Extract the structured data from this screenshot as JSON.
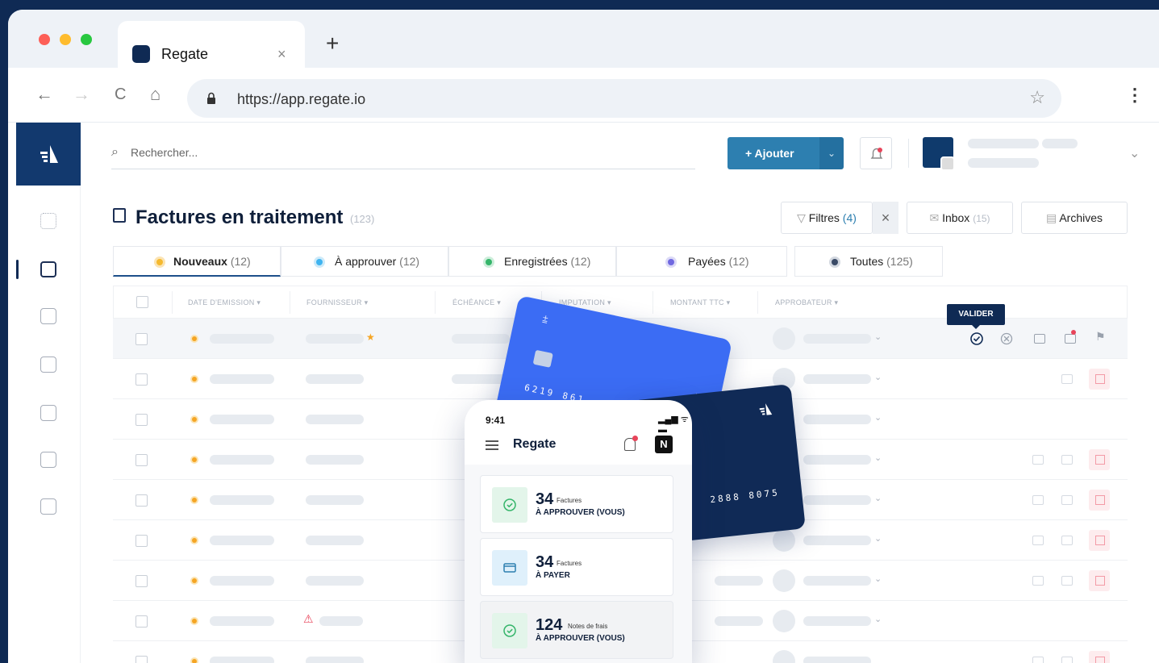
{
  "browser": {
    "tab_title": "Regate",
    "tab_close": "×",
    "new_tab": "+",
    "url": "https://app.regate.io",
    "star": "☆",
    "menu": "⋮",
    "back": "←",
    "forward": "→",
    "reload": "C",
    "home": "⌂"
  },
  "toolbar": {
    "search_placeholder": "Rechercher...",
    "add_label": "+  Ajouter",
    "add_dropdown": "⌄"
  },
  "page": {
    "title": "Factures en traitement",
    "count": "(123)"
  },
  "header_buttons": {
    "filters_label": "Filtres",
    "filters_count": "(4)",
    "filters_clear": "×",
    "inbox_label": "Inbox",
    "inbox_count": "(15)",
    "archives_label": "Archives"
  },
  "status_tabs": [
    {
      "label": "Nouveaux",
      "count": "(12)",
      "color": "#f5b92e"
    },
    {
      "label": "À approuver",
      "count": "(12)",
      "color": "#3fb4f0"
    },
    {
      "label": "Enregistrées",
      "count": "(12)",
      "color": "#35b56a"
    },
    {
      "label": "Payées",
      "count": "(12)",
      "color": "#7068e0"
    },
    {
      "label": "Toutes",
      "count": "(125)",
      "color": "#3a4a66"
    }
  ],
  "table": {
    "columns": [
      "DATE D'EMISSION ▾",
      "FOURNISSEUR ▾",
      "ÉCHÉANCE ▾",
      "IMPUTATION ▾",
      "MONTANT TTC ▾",
      "APPROBATEUR ▾"
    ],
    "tooltip": "VALIDER"
  },
  "mobile": {
    "time": "9:41",
    "status": "▂▄▆ ᯤ ▬",
    "app_name": "Regate",
    "n_logo": "N",
    "cards": [
      {
        "number": "34",
        "small": "Factures",
        "big": "À APPROUVER (VOUS)"
      },
      {
        "number": "34",
        "small": "Factures",
        "big": "À PAYER"
      },
      {
        "number": "124",
        "small": "Notes de frais",
        "big": "À APPROUVER (VOUS)"
      }
    ]
  },
  "cards": {
    "blue_number": "6219  861",
    "navy_number": "2888  8075"
  },
  "colors": {
    "brand_navy": "#0f2a54",
    "primary_button": "#2d7fb0",
    "card_blue": "#3b6cf4",
    "flag_red": "#f39aa6"
  }
}
